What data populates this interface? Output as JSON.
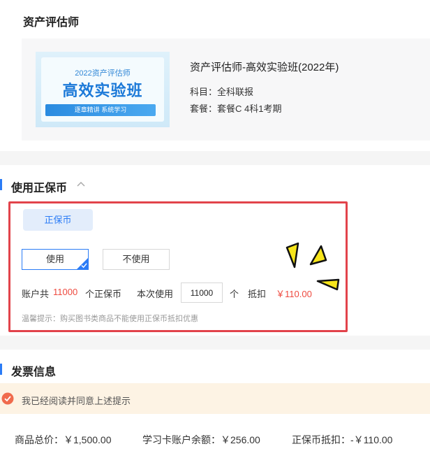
{
  "course_section": {
    "title": "资产评估师",
    "thumbnail": {
      "year_text": "2022资产评估师",
      "big_text": "高效实验班",
      "strip_text": "逐章精讲 系统学习"
    },
    "product_name": "资产评估师-高效实验班(2022年)",
    "subject": "科目：全科联报",
    "package": "套餐：套餐C 4科1考期"
  },
  "coin_section": {
    "title": "使用正保币",
    "tab_label": "正保币",
    "use_label": "使用",
    "no_use_label": "不使用",
    "selected": "使用",
    "account_prefix": "账户共",
    "account_amount": "11000",
    "account_suffix": "个正保币",
    "this_use_label": "本次使用",
    "this_use_value": "11000",
    "unit": "个",
    "deduct_label": "抵扣",
    "deduct_amount": "￥110.00",
    "tip": "温馨提示：购买图书类商品不能使用正保币抵扣优惠"
  },
  "invoice_section": {
    "title": "发票信息",
    "agree_text": "我已经阅读并同意上述提示",
    "agree_checked": true
  },
  "summary": {
    "total": "商品总价：￥1,500.00",
    "card_balance": "学习卡账户余额：￥256.00",
    "coin_deduct": "正保币抵扣：-￥110.00"
  },
  "colors": {
    "accent": "#2b7cf6",
    "highlight_red": "#ee4a3f",
    "annotation_frame": "#e2434b",
    "agree_bg": "#fdf3e4",
    "agree_icon": "#f06b4d"
  }
}
